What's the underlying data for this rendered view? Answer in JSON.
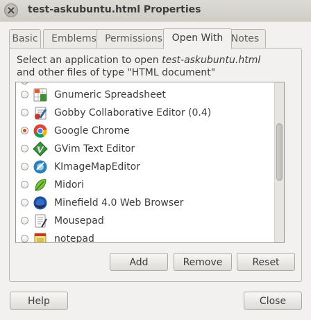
{
  "window": {
    "title": "test-askubuntu.html Properties"
  },
  "tabs": [
    {
      "label": "Basic",
      "active": false
    },
    {
      "label": "Emblems",
      "active": false
    },
    {
      "label": "Permissions",
      "active": false
    },
    {
      "label": "Open With",
      "active": true
    },
    {
      "label": "Notes",
      "active": false
    }
  ],
  "description": {
    "line1_prefix": "Select an application to open ",
    "filename": "test-askubuntu.html",
    "line2": "and other files of type \"HTML document\""
  },
  "applications": [
    {
      "name": "Gnumeric Spreadsheet",
      "icon": "gnumeric-spreadsheet-icon",
      "selected": false
    },
    {
      "name": "Gobby Collaborative Editor (0.4)",
      "icon": "gobby-editor-icon",
      "selected": false
    },
    {
      "name": "Google Chrome",
      "icon": "google-chrome-icon",
      "selected": true
    },
    {
      "name": "GVim Text Editor",
      "icon": "gvim-icon",
      "selected": false
    },
    {
      "name": "KImageMapEditor",
      "icon": "kimagemapeditor-icon",
      "selected": false
    },
    {
      "name": "Midori",
      "icon": "midori-icon",
      "selected": false
    },
    {
      "name": "Minefield 4.0 Web Browser",
      "icon": "minefield-browser-icon",
      "selected": false
    },
    {
      "name": "Mousepad",
      "icon": "mousepad-icon",
      "selected": false
    },
    {
      "name": "notepad",
      "icon": "notepad-icon",
      "selected": false
    }
  ],
  "list_scroll": {
    "position_fraction": 0.4
  },
  "buttons": {
    "add": "Add",
    "remove": "Remove",
    "reset": "Reset",
    "help": "Help",
    "close": "Close"
  },
  "colors": {
    "accent": "#dd4814",
    "window_bg": "#f2f1f0",
    "text": "#3c3c3c"
  }
}
